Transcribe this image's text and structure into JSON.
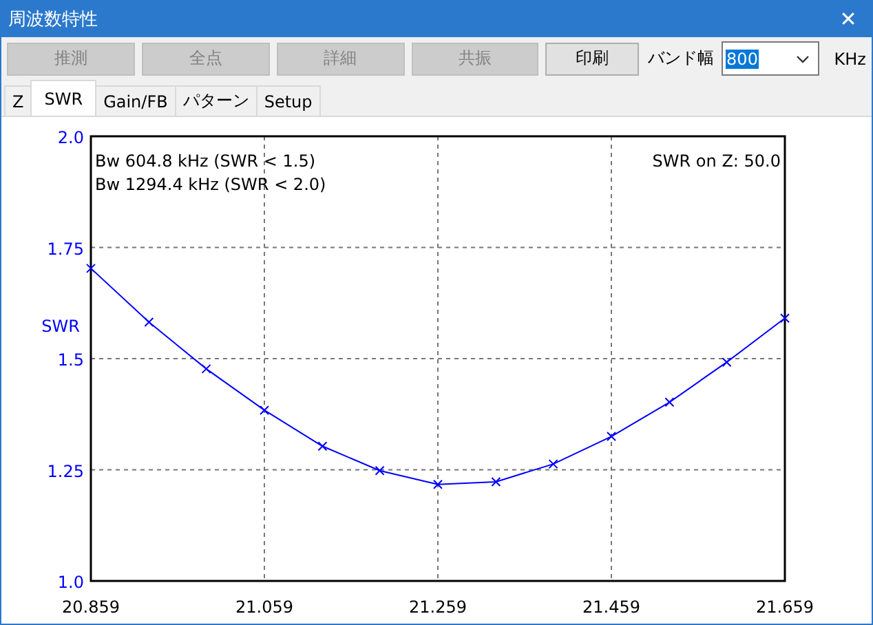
{
  "window": {
    "title": "周波数特性",
    "close": "✕"
  },
  "toolbar": {
    "buttons": [
      {
        "label": "推測",
        "disabled": true
      },
      {
        "label": "全点",
        "disabled": true
      },
      {
        "label": "詳細",
        "disabled": true
      },
      {
        "label": "共振",
        "disabled": true
      },
      {
        "label": "印刷",
        "disabled": false
      }
    ],
    "bandwidth_label": "バンド幅",
    "bandwidth_value": "800",
    "unit": "KHz"
  },
  "tabs": [
    {
      "label": "Z",
      "selected": false
    },
    {
      "label": "SWR",
      "selected": true
    },
    {
      "label": "Gain/FB",
      "selected": false
    },
    {
      "label": "パターン",
      "selected": false
    },
    {
      "label": "Setup",
      "selected": false
    }
  ],
  "chart_data": {
    "type": "line",
    "grid": true,
    "x": [
      20.859,
      20.926,
      20.992,
      21.059,
      21.126,
      21.192,
      21.259,
      21.326,
      21.392,
      21.459,
      21.526,
      21.592,
      21.659
    ],
    "series": [
      {
        "name": "SWR",
        "color": "#0000ff",
        "marker": "x",
        "values": [
          1.703,
          1.582,
          1.477,
          1.384,
          1.303,
          1.248,
          1.217,
          1.223,
          1.263,
          1.325,
          1.402,
          1.492,
          1.591
        ]
      }
    ],
    "xlim": [
      20.859,
      21.659
    ],
    "ylim": [
      1.0,
      2.0
    ],
    "xticks": [
      {
        "value": 20.859,
        "label": "20.859"
      },
      {
        "value": 21.059,
        "label": "21.059"
      },
      {
        "value": 21.259,
        "label": "21.259"
      },
      {
        "value": 21.459,
        "label": "21.459"
      },
      {
        "value": 21.659,
        "label": "21.659"
      }
    ],
    "yticks": [
      {
        "value": 1.0,
        "label": "1.0"
      },
      {
        "value": 1.25,
        "label": "1.25"
      },
      {
        "value": 1.5,
        "label": "1.5"
      },
      {
        "value": 1.75,
        "label": "1.75"
      },
      {
        "value": 2.0,
        "label": "2.0"
      }
    ],
    "annotations": [
      "Bw 604.8 kHz (SWR < 1.5)",
      "Bw 1294.4 kHz (SWR < 2.0)",
      "SWR on Z: 50.0"
    ]
  }
}
